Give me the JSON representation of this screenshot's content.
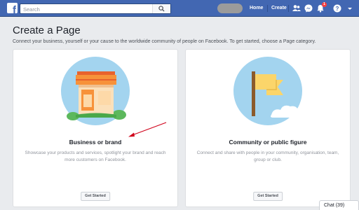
{
  "topbar": {
    "logo_letter": "f",
    "search_placeholder": "Search",
    "nav": {
      "home": "Home",
      "create": "Create"
    },
    "notifications_count": "1",
    "colors": {
      "bar": "#4267b2",
      "badge": "#fa3e3e"
    },
    "icons": [
      "friends-icon",
      "messenger-icon",
      "bell-icon",
      "help-icon",
      "chevron-down-icon"
    ]
  },
  "page": {
    "title": "Create a Page",
    "subtitle": "Connect your business, yourself or your cause to the worldwide community of people on Facebook. To get started, choose a Page category."
  },
  "cards": [
    {
      "title": "Business or brand",
      "description": "Showcase your products and services, spotlight your brand and reach more customers on Facebook.",
      "button": "Get Started",
      "icon": "storefront-icon"
    },
    {
      "title": "Community or public figure",
      "description": "Connect and share with people in your community, organisation, team, group or club.",
      "button": "Get Started",
      "icon": "flag-icon"
    }
  ],
  "chat": {
    "label": "Chat (39)"
  }
}
